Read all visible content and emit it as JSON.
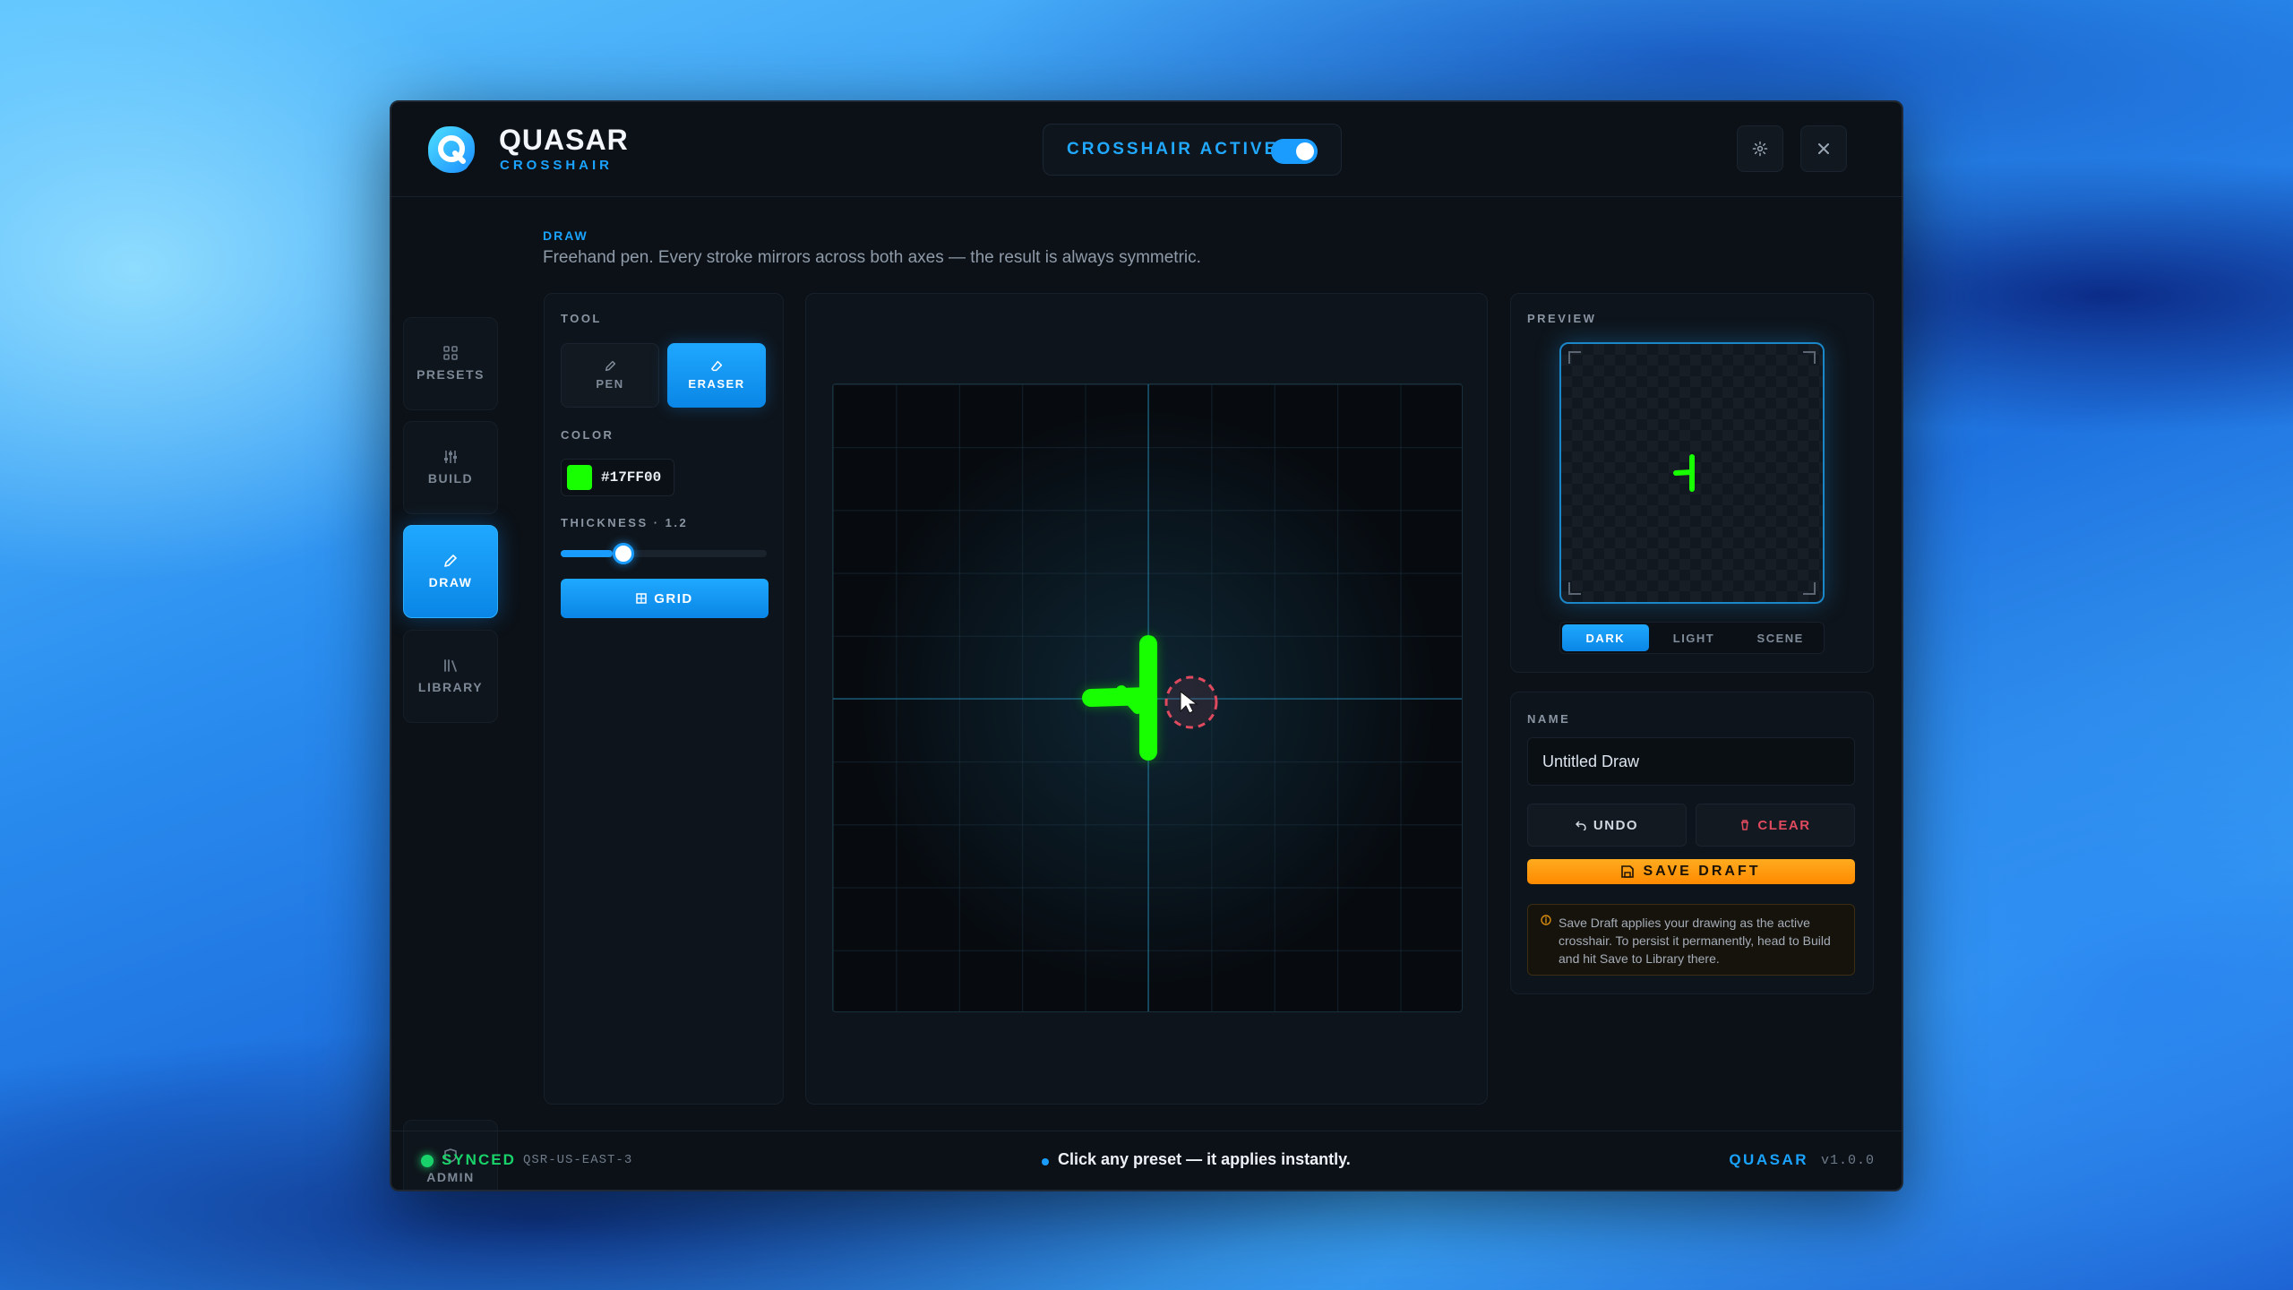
{
  "app": {
    "title": "QUASAR",
    "subtitle": "CROSSHAIR"
  },
  "header": {
    "active_label": "CROSSHAIR ACTIVE",
    "active_on": true,
    "settings_icon": "gear-icon",
    "close_icon": "close-icon"
  },
  "sidebar": {
    "items": [
      {
        "label": "PRESETS",
        "icon": "grid-icon"
      },
      {
        "label": "BUILD",
        "icon": "sliders-icon"
      },
      {
        "label": "DRAW",
        "icon": "pencil-icon",
        "active": true
      },
      {
        "label": "LIBRARY",
        "icon": "books-icon"
      }
    ],
    "admin": {
      "label": "ADMIN",
      "icon": "shield-icon"
    }
  },
  "section": {
    "tag": "DRAW",
    "description": "Freehand pen. Every stroke mirrors across both axes — the result is always symmetric."
  },
  "tools": {
    "label": "TOOL",
    "pen_label": "PEN",
    "eraser_label": "ERASER",
    "selected": "ERASER",
    "color_label": "COLOR",
    "color_hex": "#17FF00",
    "color_text": "#17FF00",
    "thickness_label": "THICKNESS · 1.2",
    "thickness_fraction": 0.25,
    "grid_label": "GRID"
  },
  "preview": {
    "label": "PREVIEW",
    "modes": [
      "DARK",
      "LIGHT",
      "SCENE"
    ],
    "selected_mode": "DARK"
  },
  "name_panel": {
    "label": "NAME",
    "value": "Untitled Draw",
    "undo_label": "UNDO",
    "clear_label": "CLEAR",
    "save_label": "SAVE DRAFT",
    "note": "Save Draft applies your drawing as the active crosshair. To persist it permanently, head to Build and hit Save to Library there."
  },
  "footer": {
    "sync_label": "SYNCED",
    "region": "QSR-US-EAST-3",
    "tip": "Click any preset — it applies instantly.",
    "brand": "QUASAR",
    "version": "v1.0.0"
  },
  "colors": {
    "accent": "#1A9CFF",
    "stroke": "#17FF00",
    "save": "#FF9A10",
    "clear": "#E04A5F",
    "synced": "#19D36A"
  }
}
